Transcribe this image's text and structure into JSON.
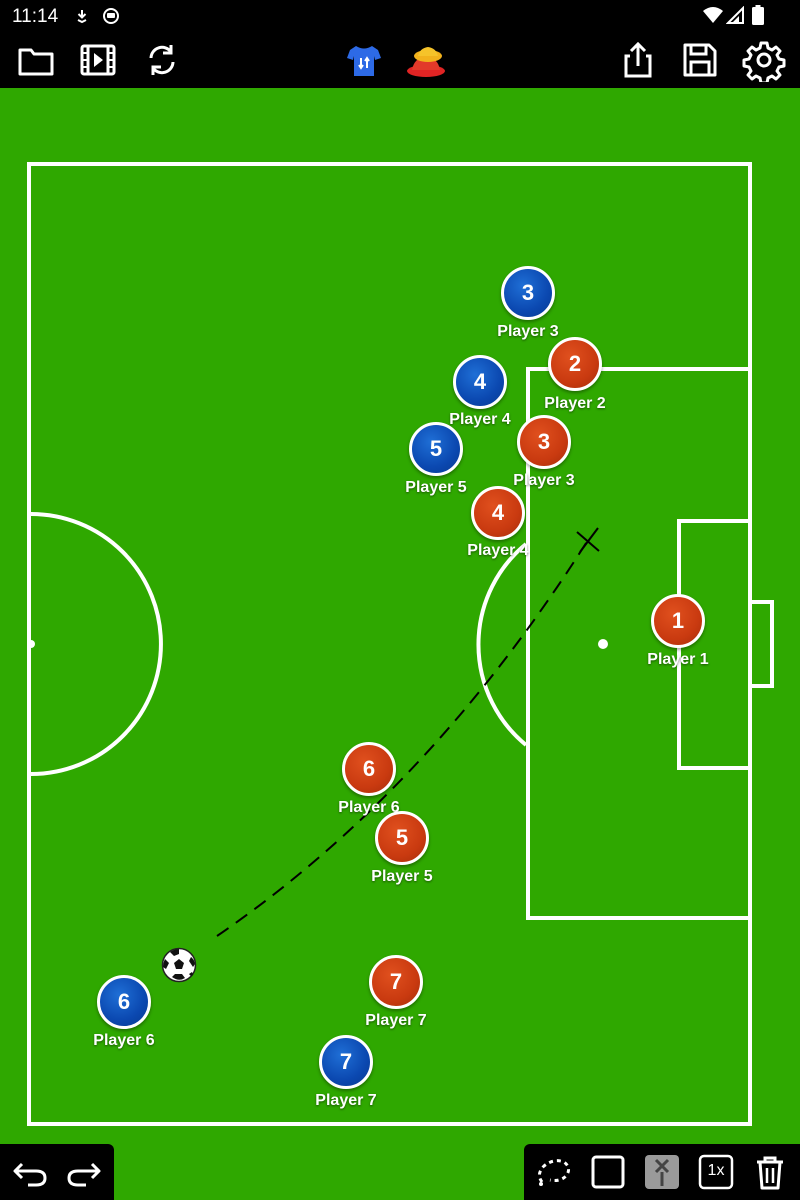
{
  "status_bar": {
    "time": "11:14",
    "icons": [
      "download-icon",
      "sync-icon",
      "wifi-icon",
      "signal-icon",
      "battery-icon"
    ]
  },
  "toolbar": {
    "left_icons": [
      "folder-icon",
      "video-icon",
      "refresh-icon"
    ],
    "center_icons": [
      "jersey-icon",
      "cones-icon"
    ],
    "right_icons": [
      "share-icon",
      "save-icon",
      "gear-icon"
    ]
  },
  "colors": {
    "field": "#2fa800",
    "lines": "#ffffff",
    "team_blue": "#0b48b0",
    "team_red": "#c93a10",
    "bars": "#000000"
  },
  "players": {
    "blue": [
      {
        "number": "3",
        "label": "Player 3"
      },
      {
        "number": "4",
        "label": "Player 4"
      },
      {
        "number": "5",
        "label": "Player 5"
      },
      {
        "number": "6",
        "label": "Player 6"
      },
      {
        "number": "7",
        "label": "Player 7"
      }
    ],
    "red": [
      {
        "number": "1",
        "label": "Player 1"
      },
      {
        "number": "2",
        "label": "Player 2"
      },
      {
        "number": "3",
        "label": "Player 3"
      },
      {
        "number": "4",
        "label": "Player 4"
      },
      {
        "number": "5",
        "label": "Player 5"
      },
      {
        "number": "6",
        "label": "Player 6"
      },
      {
        "number": "7",
        "label": "Player 7"
      }
    ]
  },
  "bottom_toolbar": {
    "left_icons": [
      "undo-icon",
      "redo-icon"
    ],
    "right_icons": [
      "lasso-icon",
      "rectangle-icon",
      "pin-icon",
      "speed-icon",
      "trash-icon"
    ],
    "speed_label": "1x"
  }
}
